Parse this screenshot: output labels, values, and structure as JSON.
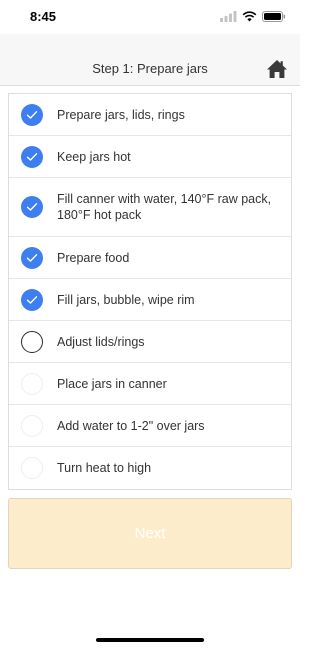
{
  "status_bar": {
    "time": "8:45",
    "icons": [
      "signal-icon",
      "wifi-icon",
      "battery-icon"
    ]
  },
  "header": {
    "title": "Step 1: Prepare jars",
    "home_icon": "home-icon"
  },
  "checklist": {
    "items": [
      {
        "label": "Prepare jars, lids, rings",
        "state": "checked"
      },
      {
        "label": "Keep jars hot",
        "state": "checked"
      },
      {
        "label": "Fill canner with water, 140°F raw pack, 180°F hot pack",
        "state": "checked"
      },
      {
        "label": "Prepare food",
        "state": "checked"
      },
      {
        "label": "Fill jars, bubble, wipe rim",
        "state": "checked"
      },
      {
        "label": "Adjust lids/rings",
        "state": "current"
      },
      {
        "label": "Place jars in canner",
        "state": "pending"
      },
      {
        "label": "Add water to 1-2\" over jars",
        "state": "pending"
      },
      {
        "label": "Turn heat to high",
        "state": "pending"
      }
    ]
  },
  "footer": {
    "next_label": "Next"
  },
  "colors": {
    "accent": "#3d7ff0",
    "next_bg": "#fdeccc",
    "nav_bg": "#f7f7f7"
  }
}
